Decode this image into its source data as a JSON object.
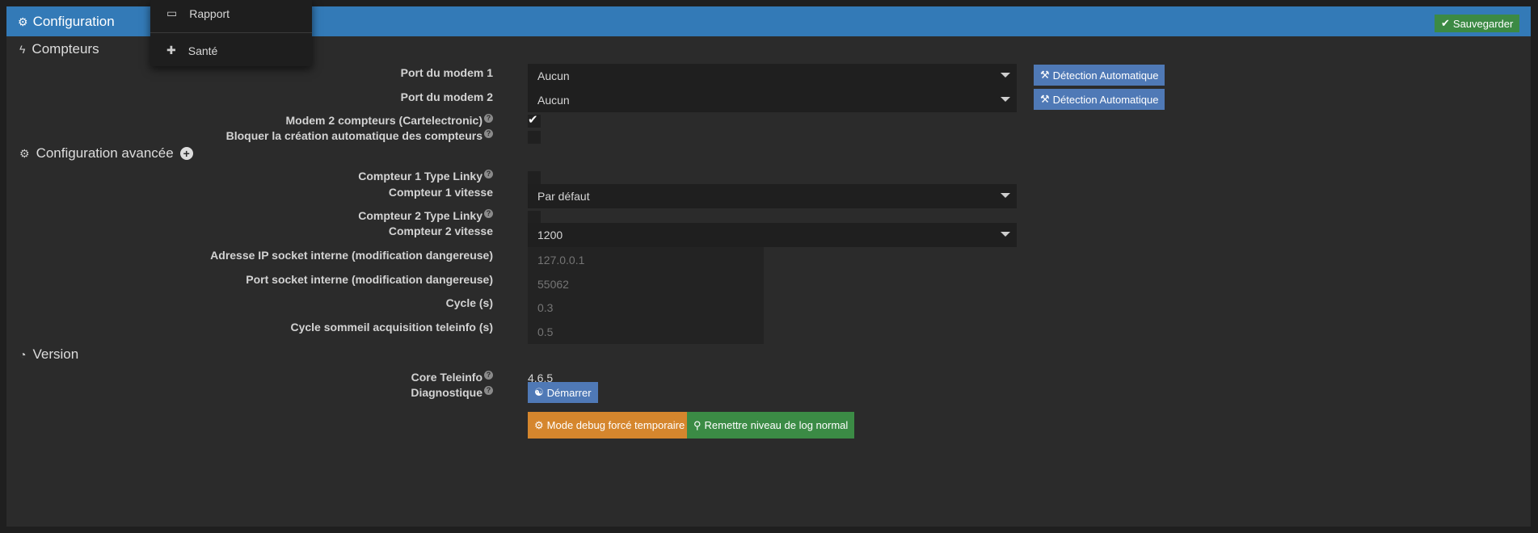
{
  "header": {
    "title": "Configuration",
    "save_label": "Sauvegarder",
    "header_color": "#337ab7",
    "save_color": "#3c8a44"
  },
  "dropdown_menu": {
    "items": [
      {
        "label": "Rapport",
        "icon": "report-icon"
      },
      {
        "label": "Santé",
        "icon": "medkit-icon"
      }
    ]
  },
  "sections": {
    "compteurs": "Compteurs",
    "advanced": "Configuration avancée",
    "version": "Version"
  },
  "fields": {
    "modem1": {
      "label": "Port du modem 1",
      "value": "Aucun",
      "button": "Détection Automatique"
    },
    "modem2": {
      "label": "Port du modem 2",
      "value": "Aucun",
      "button": "Détection Automatique"
    },
    "modem_2_compteurs": {
      "label": "Modem 2 compteurs (Cartelectronic)",
      "checked": true
    },
    "block_auto_create": {
      "label": "Bloquer la création automatique des compteurs",
      "checked": false
    },
    "c1_linky": {
      "label": "Compteur 1 Type Linky",
      "checked": false
    },
    "c1_speed": {
      "label": "Compteur 1 vitesse",
      "value": "Par défaut"
    },
    "c2_linky": {
      "label": "Compteur 2 Type Linky",
      "checked": false
    },
    "c2_speed": {
      "label": "Compteur 2 vitesse",
      "value": "1200"
    },
    "socket_ip": {
      "label": "Adresse IP socket interne (modification dangereuse)",
      "placeholder": "127.0.0.1"
    },
    "socket_port": {
      "label": "Port socket interne (modification dangereuse)",
      "placeholder": "55062"
    },
    "cycle": {
      "label": "Cycle (s)",
      "placeholder": "0.3"
    },
    "cycle_sleep": {
      "label": "Cycle sommeil acquisition teleinfo (s)",
      "placeholder": "0.5"
    },
    "core": {
      "label": "Core Teleinfo",
      "value": "4.6.5"
    },
    "diagnostic": {
      "label": "Diagnostique",
      "button": "Démarrer"
    }
  },
  "actions": {
    "debug": "Mode debug forcé temporaire",
    "reset_log": "Remettre niveau de log normal"
  }
}
